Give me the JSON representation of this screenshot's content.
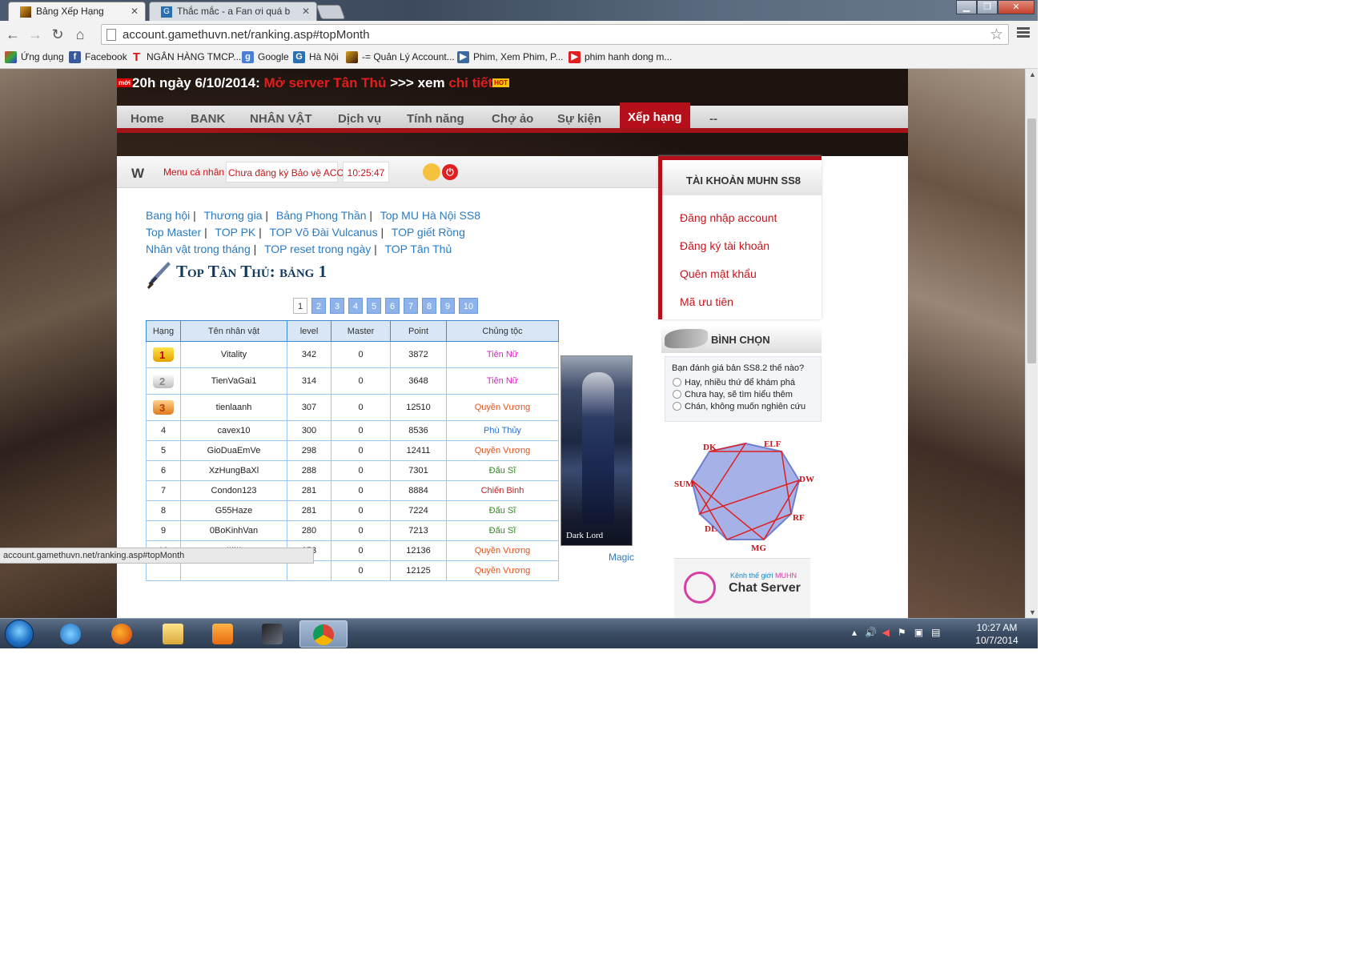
{
  "browser": {
    "tabs": [
      {
        "title": "Bảng Xếp Hạng",
        "active": true
      },
      {
        "title": "Thắc mắc - a Fan ơi quá b",
        "active": false
      }
    ],
    "url": "account.gamethuvn.net/ranking.asp#topMonth",
    "bookmarks": [
      "Ứng dụng",
      "Facebook",
      "NGÂN HÀNG TMCP...",
      "Google",
      "Hà Nội",
      "-= Quản Lý Account...",
      "Phim, Xem Phim, P...",
      "phim hanh dong m..."
    ],
    "status_url": "account.gamethuvn.net/ranking.asp#topMonth"
  },
  "site": {
    "announcement": {
      "badge": "mới",
      "date": "20h ngày 6/10/2014:",
      "event": "Mở server Tân Thủ",
      "arrows": ">>> xem",
      "detail": "chi tiết",
      "hot": "HOT"
    },
    "nav": [
      "Home",
      "BANK",
      "NHÂN VẬT",
      "Dịch vụ",
      "Tính năng",
      "Chợ ảo",
      "Sự kiện",
      "Xếp hạng",
      "--"
    ],
    "nav_active": "Xếp hạng",
    "userbar": {
      "logo": "W",
      "menu": "Menu cá nhân",
      "protect": "Chưa đăng ký Bảo vệ ACC",
      "time": "10:25:47"
    },
    "rank_links": [
      "Bang hội",
      "Thương gia",
      "Bảng Phong Thần",
      "Top MU Hà Nội SS8",
      "Top Master",
      "TOP PK",
      "TOP Võ Đài Vulcanus",
      "TOP giết Rồng",
      "Nhân vật trong tháng",
      "TOP reset trong ngày",
      "TOP Tân Thủ"
    ],
    "page_title": "Top Tân Thủ: bảng 1",
    "pages": [
      "1",
      "2",
      "3",
      "4",
      "5",
      "6",
      "7",
      "8",
      "9",
      "10"
    ],
    "current_page": "1",
    "table": {
      "headers": [
        "Hạng",
        "Tên nhân vật",
        "level",
        "Master",
        "Point",
        "Chủng tộc"
      ],
      "rows": [
        {
          "rank": "1",
          "name": "Vitality",
          "level": "342",
          "master": "0",
          "point": "3872",
          "race": "Tiên Nữ",
          "race_color": "#e020c8"
        },
        {
          "rank": "2",
          "name": "TienVaGai1",
          "level": "314",
          "master": "0",
          "point": "3648",
          "race": "Tiên Nữ",
          "race_color": "#e020c8"
        },
        {
          "rank": "3",
          "name": "tienlaanh",
          "level": "307",
          "master": "0",
          "point": "12510",
          "race": "Quyền Vương",
          "race_color": "#e0531e"
        },
        {
          "rank": "4",
          "name": "cavex10",
          "level": "300",
          "master": "0",
          "point": "8536",
          "race": "Phù Thủy",
          "race_color": "#2a6fd0"
        },
        {
          "rank": "5",
          "name": "GioDuaEmVe",
          "level": "298",
          "master": "0",
          "point": "12411",
          "race": "Quyền Vương",
          "race_color": "#e0531e"
        },
        {
          "rank": "6",
          "name": "XzHungBaXl",
          "level": "288",
          "master": "0",
          "point": "7301",
          "race": "Đấu Sĩ",
          "race_color": "#2e8a1e"
        },
        {
          "rank": "7",
          "name": "Condon123",
          "level": "281",
          "master": "0",
          "point": "8884",
          "race": "Chiến Binh",
          "race_color": "#c42020"
        },
        {
          "rank": "8",
          "name": "G55Haze",
          "level": "281",
          "master": "0",
          "point": "7224",
          "race": "Đấu Sĩ",
          "race_color": "#2e8a1e"
        },
        {
          "rank": "9",
          "name": "0BoKinhVan",
          "level": "280",
          "master": "0",
          "point": "7213",
          "race": "Đấu Sĩ",
          "race_color": "#2e8a1e"
        },
        {
          "rank": "10",
          "name": "IIIIII",
          "level": "273",
          "master": "0",
          "point": "12136",
          "race": "Quyền Vương",
          "race_color": "#e0531e"
        },
        {
          "rank": "",
          "name": "",
          "level": "",
          "master": "0",
          "point": "12125",
          "race": "Quyền Vương",
          "race_color": "#e0531e"
        }
      ]
    },
    "char_caption": "Dark Lord",
    "magic_link": "Magic",
    "account_box": {
      "title": "TÀI KHOẢN MUHN SS8",
      "items": [
        "Đăng nhập account",
        "Đăng ký tài khoản",
        "Quên mật khẩu",
        "Mã ưu tiên"
      ]
    },
    "poll": {
      "title": "BÌNH CHỌN",
      "question": "Bạn đánh giá bản SS8.2 thế nào?",
      "options": [
        "Hay, nhiều thứ để khám phá",
        "Chưa hay, sẽ tìm hiểu thêm",
        "Chán, không muốn nghiên cứu"
      ]
    },
    "class_ring": [
      "DK",
      "ELF",
      "DW",
      "RF",
      "MG",
      "DL",
      "SUM"
    ],
    "chat": {
      "kenh": "Kênh thế giới",
      "brand": "MUHN",
      "label": "Chat Server"
    }
  },
  "taskbar": {
    "time": "10:27 AM",
    "date": "10/7/2014"
  },
  "colors": {
    "nav_red": "#b50f1a",
    "link_blue": "#2b7bc2",
    "table_border": "#3f8ad6"
  }
}
